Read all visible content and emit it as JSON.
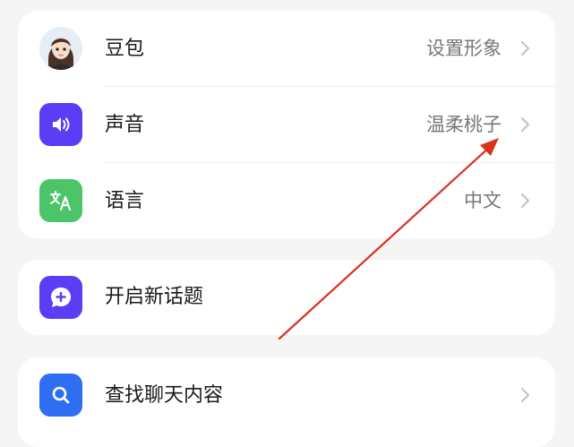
{
  "settings_card": {
    "rows": [
      {
        "label": "豆包",
        "value": "设置形象",
        "icon": "avatar-icon"
      },
      {
        "label": "声音",
        "value": "温柔桃子",
        "icon": "speaker-icon",
        "icon_color": "#5b3df5"
      },
      {
        "label": "语言",
        "value": "中文",
        "icon": "translate-icon",
        "icon_color": "#4cc46a"
      }
    ]
  },
  "new_topic_card": {
    "label": "开启新话题",
    "icon": "chat-plus-icon",
    "icon_color": "#5b3df5"
  },
  "search_card": {
    "label": "查找聊天内容",
    "icon": "search-icon",
    "icon_color": "#2f6ef2"
  },
  "annotation": {
    "icon": "red-arrow-icon",
    "color": "#d9321f"
  }
}
